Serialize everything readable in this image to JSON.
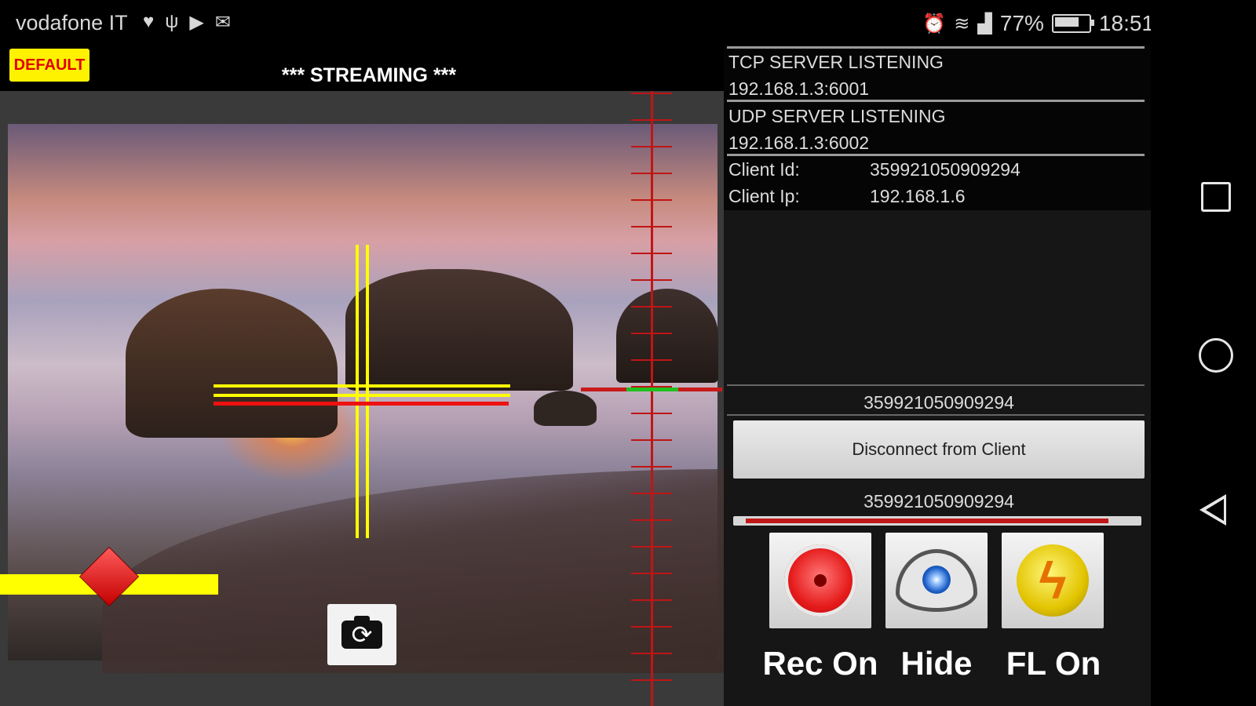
{
  "status_bar": {
    "carrier": "vodafone IT",
    "battery": "77%",
    "time": "18:51",
    "icons": [
      "heart-icon",
      "usb-icon",
      "media-icon",
      "mail-icon",
      "alarm-icon",
      "wifi-icon",
      "signal-icon",
      "battery-icon"
    ]
  },
  "header": {
    "profile_badge": "DEFAULT",
    "title": "*** STREAMING ***"
  },
  "server": {
    "tcp_label": "TCP SERVER LISTENING",
    "tcp_address": "192.168.1.3:6001",
    "udp_label": "UDP SERVER LISTENING",
    "udp_address": "192.168.1.3:6002",
    "client_id_label": "Client Id:",
    "client_id": "359921050909294",
    "client_ip_label": "Client Ip:",
    "client_ip": "192.168.1.6"
  },
  "connection": {
    "client_id_top": "359921050909294",
    "disconnect_label": "Disconnect from Client",
    "client_id_bottom": "359921050909294",
    "progress_fraction": 0.95
  },
  "actions": [
    {
      "label": "Rec On",
      "icon": "record-icon"
    },
    {
      "label": "Hide",
      "icon": "eye-icon"
    },
    {
      "label": "FL On",
      "icon": "flash-icon"
    }
  ],
  "camera": {
    "zoom_slider_fraction": 0.5
  },
  "colors": {
    "badge_bg": "#fff200",
    "badge_text": "#e00000",
    "crosshair": "#ffff00",
    "level_line": "#ee1111",
    "ruler": "#c01515"
  }
}
